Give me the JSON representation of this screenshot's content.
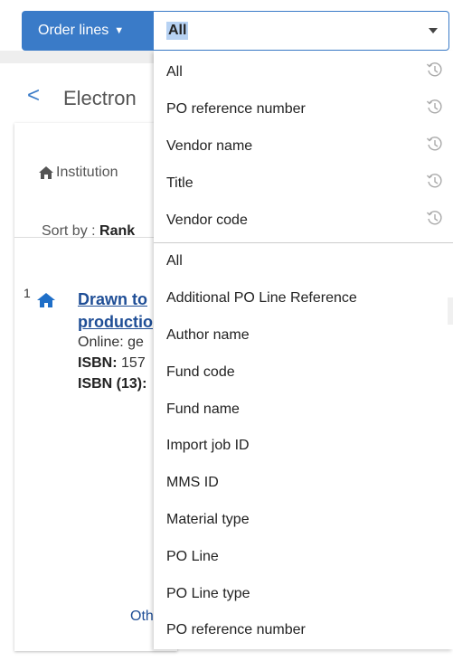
{
  "search": {
    "scope_label": "Order lines",
    "selected_field": "All"
  },
  "background": {
    "title": "Electron",
    "institution_label": "Institution",
    "sort_by_label": "Sort by :",
    "sort_by_value": "Rank",
    "result": {
      "index": "1",
      "title_line1": "Drawn to",
      "title_line2": "productio",
      "online_text": "Online: ge",
      "isbn_label": "ISBN:",
      "isbn_value": "157",
      "isbn13_label": "ISBN (13):"
    },
    "other_link": "Oth"
  },
  "dropdown": {
    "recent": [
      {
        "label": "All",
        "icon": "history-icon"
      },
      {
        "label": "PO reference number",
        "icon": "history-icon"
      },
      {
        "label": "Vendor name",
        "icon": "history-icon"
      },
      {
        "label": "Title",
        "icon": "history-icon"
      },
      {
        "label": "Vendor code",
        "icon": "history-icon"
      }
    ],
    "fields": [
      "All",
      "Additional PO Line Reference",
      "Author name",
      "Fund code",
      "Fund name",
      "Import job ID",
      "MMS ID",
      "Material type",
      "PO Line",
      "PO Line type",
      "PO reference number"
    ]
  },
  "colors": {
    "accent": "#3a7bc8",
    "link": "#1f4e96"
  }
}
